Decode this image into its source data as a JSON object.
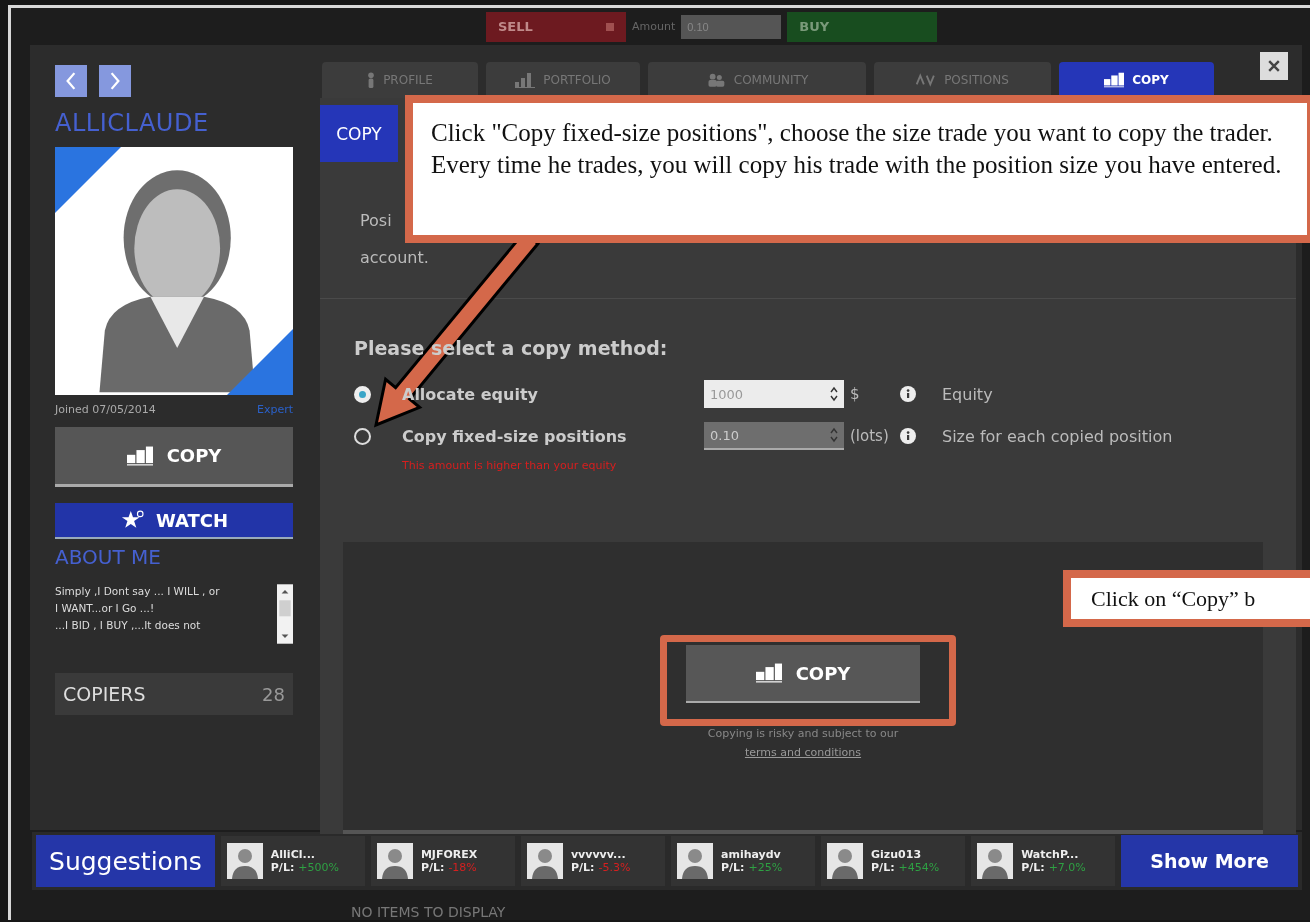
{
  "trade_bar": {
    "sell": "SELL",
    "amount_label": "Amount",
    "amount": "0.10",
    "buy": "BUY"
  },
  "profile": {
    "name": "ALLICLAUDE",
    "joined": "Joined 07/05/2014",
    "rank": "Expert",
    "copy_button": "COPY",
    "watch_button": "WATCH",
    "about_title": "ABOUT ME",
    "about_lines": [
      "Simply ,I Dont say ... I WILL , or",
      "I WANT...or I Go ...!",
      "...I BID , I BUY ,...It does not"
    ],
    "copiers_label": "COPIERS",
    "copiers_count": "28"
  },
  "tabs": [
    {
      "label": "PROFILE",
      "selected": false
    },
    {
      "label": "PORTFOLIO",
      "selected": false
    },
    {
      "label": "COMMUNITY",
      "selected": false
    },
    {
      "label": "POSITIONS",
      "selected": false
    },
    {
      "label": "COPY",
      "selected": true
    }
  ],
  "subtab": "COPY",
  "description": [
    "Posi",
    "account."
  ],
  "copy_method": {
    "title": "Please select a copy method:",
    "options": [
      {
        "label": "Allocate equity",
        "value": "1000",
        "unit": "$",
        "hint": "Equity",
        "selected": true,
        "disabled": false
      },
      {
        "label": "Copy fixed-size positions",
        "value": "0.10",
        "unit": "(lots)",
        "hint": "Size for each copied position",
        "selected": false,
        "disabled": true
      }
    ],
    "error": "This amount is higher than your equity"
  },
  "copy_button": "COPY",
  "disclaimer": "Copying is risky and subject to our",
  "terms_link": "terms and conditions",
  "empty_message": "NO ITEMS TO DISPLAY",
  "suggestions": {
    "title": "Suggestions",
    "more": "Show More",
    "items": [
      {
        "name": "AlliCl...",
        "pl_label": "P/L:",
        "pl": "+500%",
        "color": "#2ea043"
      },
      {
        "name": "MJFOREX",
        "pl_label": "P/L:",
        "pl": "-18%",
        "color": "#d42020"
      },
      {
        "name": "vvvvvv...",
        "pl_label": "P/L:",
        "pl": "-5.3%",
        "color": "#d42020"
      },
      {
        "name": "amihaydv",
        "pl_label": "P/L:",
        "pl": "+25%",
        "color": "#2ea043"
      },
      {
        "name": "Gizu013",
        "pl_label": "P/L:",
        "pl": "+454%",
        "color": "#2ea043"
      },
      {
        "name": "WatchP...",
        "pl_label": "P/L:",
        "pl": "+7.0%",
        "color": "#2ea043"
      }
    ]
  },
  "callouts": [
    "Click \"Copy fixed-size positions\", choose the size trade you want to copy the trader. Every time he trades, you will copy his trade with the position size you have entered.",
    "Click on “Copy” b"
  ]
}
